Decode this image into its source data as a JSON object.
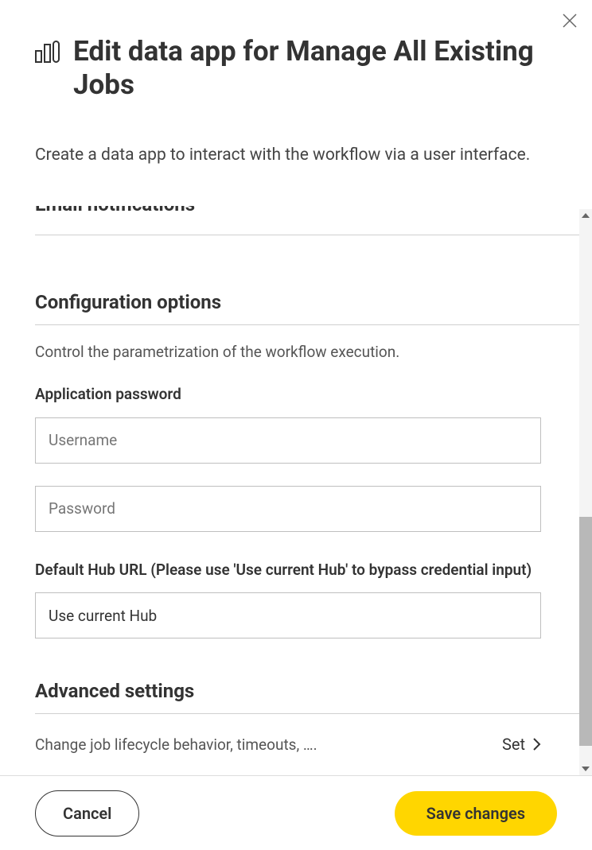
{
  "header": {
    "title": "Edit data app for Manage All Existing Jobs",
    "subtitle": "Create a data app to interact with the workflow via a user interface."
  },
  "prev_section": {
    "title": "Email notifications"
  },
  "config": {
    "title": "Configuration options",
    "desc": "Control the parametrization of the workflow execution.",
    "app_password_label": "Application password",
    "username_placeholder": "Username",
    "username_value": "",
    "password_placeholder": "Password",
    "password_value": "",
    "hub_label": "Default Hub URL (Please use 'Use current Hub' to bypass credential input)",
    "hub_value": "Use current Hub"
  },
  "advanced": {
    "title": "Advanced settings",
    "desc": "Change job lifecycle behavior, timeouts, ….",
    "set_label": "Set"
  },
  "footer": {
    "cancel": "Cancel",
    "save": "Save changes"
  }
}
